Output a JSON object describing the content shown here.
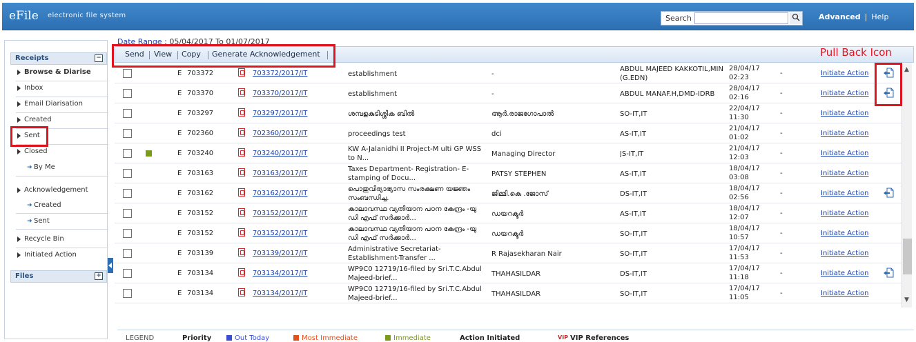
{
  "header": {
    "brand": "eFile",
    "brand_sub": "electronic file system",
    "search_label": "Search",
    "search_placeholder": "",
    "advanced": "Advanced",
    "help": "Help"
  },
  "sidebar": {
    "receipts_title": "Receipts",
    "receipts_toggle": "−",
    "items": [
      {
        "label": "Browse & Diarise"
      },
      {
        "label": "Inbox"
      },
      {
        "label": "Email Diarisation"
      },
      {
        "label": "Created"
      },
      {
        "label": "Sent"
      },
      {
        "label": "Closed"
      },
      {
        "label": "By Me"
      },
      {
        "label": "Acknowledgement"
      },
      {
        "label": "Created"
      },
      {
        "label": "Sent"
      },
      {
        "label": "Recycle Bin"
      },
      {
        "label": "Initiated Action"
      }
    ],
    "files_title": "Files",
    "files_toggle": "+"
  },
  "date_range": {
    "label": "Date Range",
    "value": ": 05/04/2017 To 01/07/2017"
  },
  "toolbar": {
    "send": "Send",
    "view": "View",
    "copy": "Copy",
    "generate": "Generate Acknowledgement"
  },
  "annotation": {
    "pull_back_label": "Pull Back Icon"
  },
  "rows": [
    {
      "type": "E",
      "num": "703372",
      "file": "703372/2017/IT",
      "subject": "establishment",
      "from": "-",
      "to": "ABDUL MAJEED KAKKOTIL,MIN (G.EDN)",
      "date": "28/04/17",
      "time": "02:23",
      "dash": "-",
      "action": "Initiate Action"
    },
    {
      "type": "E",
      "num": "703370",
      "file": "703370/2017/IT",
      "subject": "establishment",
      "from": "-",
      "to": "ABDUL MANAF.H,DMD-IDRB",
      "date": "28/04/17",
      "time": "02:16",
      "dash": "-",
      "action": "Initiate Action"
    },
    {
      "type": "E",
      "num": "703297",
      "file": "703297/2017/IT",
      "subject": "ശമ്പളകുടിശ്ശിക ബിൽ",
      "from": "ആർ.രാജഗോപാൽ",
      "to": "SO-IT,IT",
      "date": "22/04/17",
      "time": "11:30",
      "dash": "-",
      "action": "Initiate Action"
    },
    {
      "type": "E",
      "num": "702360",
      "file": "702360/2017/IT",
      "subject": "proceedings test",
      "from": "dci",
      "to": "AS-IT,IT",
      "date": "21/04/17",
      "time": "01:02",
      "dash": "-",
      "action": "Initiate Action"
    },
    {
      "type": "E",
      "num": "703240",
      "file": "703240/2017/IT",
      "subject": "KW A-Jalanidhi II Project-M ulti GP WSS to N...",
      "from": "Managing Director",
      "to": "JS-IT,IT",
      "date": "21/04/17",
      "time": "12:03",
      "dash": "-",
      "action": "Initiate Action"
    },
    {
      "type": "E",
      "num": "703163",
      "file": "703163/2017/IT",
      "subject": "Taxes Department- Registration- E-stamping of Docu...",
      "from": "PATSY STEPHEN",
      "to": "AS-IT,IT",
      "date": "18/04/17",
      "time": "03:08",
      "dash": "-",
      "action": "Initiate Action"
    },
    {
      "type": "E",
      "num": "703162",
      "file": "703162/2017/IT",
      "subject": "പൊതുവിദ്യാഭ്യാസ സംരക്ഷണ യജ്ഞം സംബന്ധിച്ച.",
      "from": "ജിമ്മി.കെ .ജോസ്",
      "to": "DS-IT,IT",
      "date": "18/04/17",
      "time": "02:56",
      "dash": "-",
      "action": "Initiate Action"
    },
    {
      "type": "E",
      "num": "703152",
      "file": "703152/2017/IT",
      "subject": "കാലാവസ്ഥ വ്യതിയാന പഠന കേന്ദ്രം -യു ഡി എഫ് സർക്കാർ...",
      "from": "ഡയറക്ടർ",
      "to": "AS-IT,IT",
      "date": "18/04/17",
      "time": "12:07",
      "dash": "-",
      "action": "Initiate Action"
    },
    {
      "type": "E",
      "num": "703152",
      "file": "703152/2017/IT",
      "subject": "കാലാവസ്ഥ വ്യതിയാന പഠന കേന്ദ്രം -യു ഡി എഫ് സർക്കാർ...",
      "from": "ഡയറക്ടർ",
      "to": "SO-IT,IT",
      "date": "18/04/17",
      "time": "10:57",
      "dash": "-",
      "action": "Initiate Action"
    },
    {
      "type": "E",
      "num": "703139",
      "file": "703139/2017/IT",
      "subject": "Administrative Secretariat- Establishment-Transfer ...",
      "from": "R Rajasekharan Nair",
      "to": "SO-IT,IT",
      "date": "17/04/17",
      "time": "11:53",
      "dash": "-",
      "action": "Initiate Action"
    },
    {
      "type": "E",
      "num": "703134",
      "file": "703134/2017/IT",
      "subject": "WP9C0 12719/16-filed by Sri.T.C.Abdul Majeed-brief...",
      "from": "THAHASILDAR",
      "to": "DS-IT,IT",
      "date": "17/04/17",
      "time": "11:18",
      "dash": "-",
      "action": "Initiate Action"
    },
    {
      "type": "E",
      "num": "703134",
      "file": "703134/2017/IT",
      "subject": "WP9C0 12719/16-filed by Sri.T.C.Abdul Majeed-brief...",
      "from": "THAHASILDAR",
      "to": "SO-IT,IT",
      "date": "17/04/17",
      "time": "11:05",
      "dash": "-",
      "action": "Initiate Action"
    }
  ],
  "legend": {
    "title": "LEGEND",
    "priority": "Priority",
    "out_today": "Out Today",
    "most_immediate": "Most Immediate",
    "immediate": "Immediate",
    "action_initiated": "Action Initiated",
    "vip": "VIP",
    "vip_ref": "VIP References"
  },
  "colors": {
    "header": "#2d6fb3",
    "link": "#1a3faa",
    "annotation": "#e0141e",
    "out_today": "#3a4fcf",
    "most_immediate": "#e0501e",
    "immediate": "#7a9a1a"
  }
}
